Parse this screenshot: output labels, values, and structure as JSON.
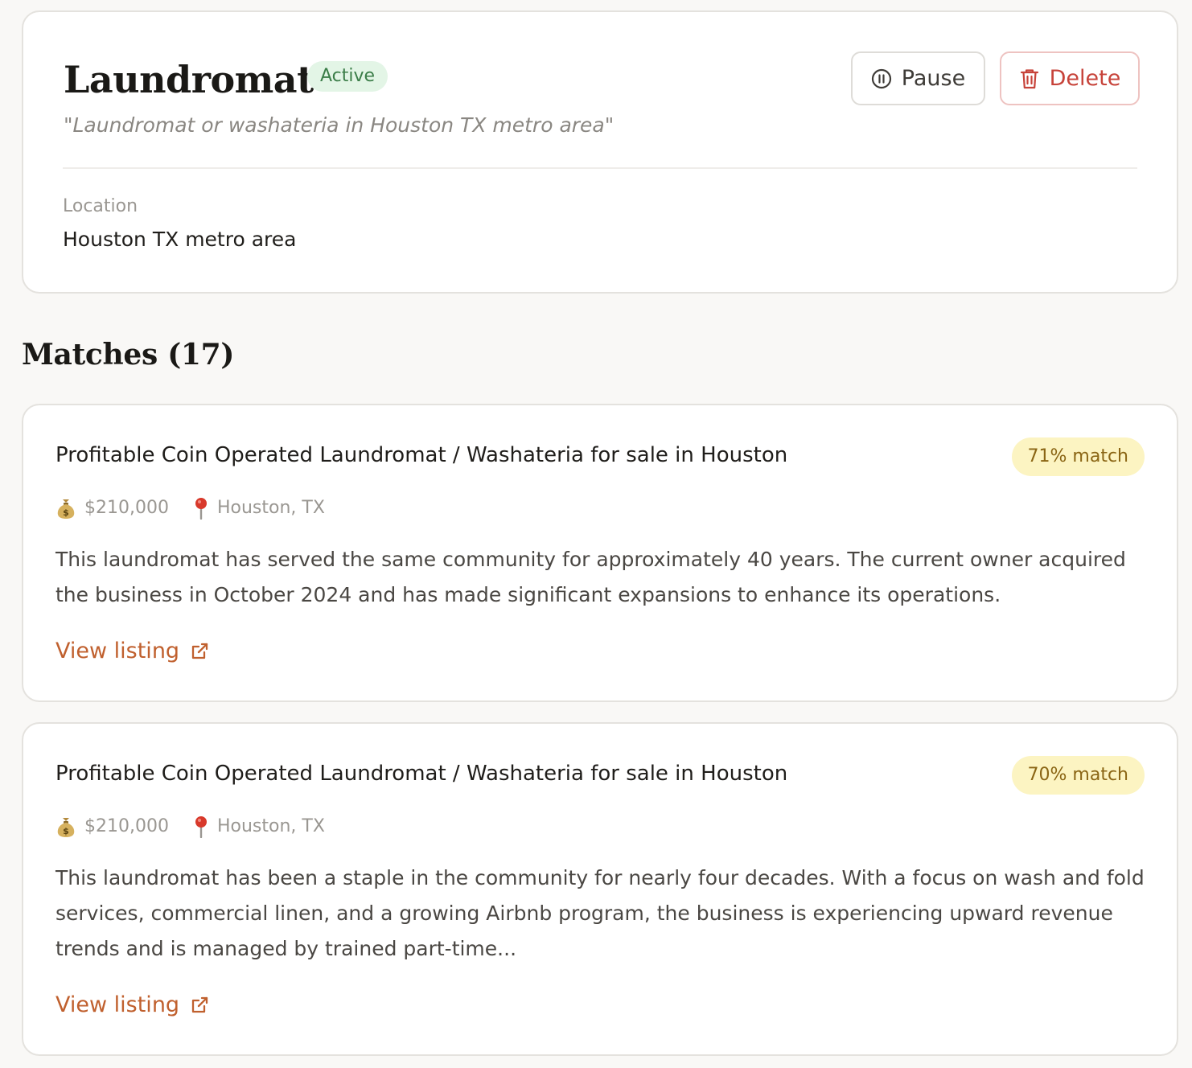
{
  "search": {
    "title": "Laundromat",
    "status": "Active",
    "query": "\"Laundromat or washateria in Houston TX metro area\"",
    "pause_label": "Pause",
    "delete_label": "Delete",
    "location_label": "Location",
    "location_value": "Houston TX metro area"
  },
  "matches": {
    "heading": "Matches (17)",
    "items": [
      {
        "title": "Profitable Coin Operated Laundromat / Washateria for sale in Houston",
        "match": "71% match",
        "price": "$210,000",
        "location": "Houston, TX",
        "description": "This laundromat has served the same community for approximately 40 years. The current owner acquired the business in October 2024 and has made significant expansions to enhance its operations.",
        "link_label": "View listing"
      },
      {
        "title": "Profitable Coin Operated Laundromat / Washateria for sale in Houston",
        "match": "70% match",
        "price": "$210,000",
        "location": "Houston, TX",
        "description": "This laundromat has been a staple in the community for nearly four decades. With a focus on wash and fold services, commercial linen, and a growing Airbnb program, the business is experiencing upward revenue trends and is managed by trained part-time...",
        "link_label": "View listing"
      }
    ]
  },
  "icons": {
    "price": "money-bag-icon",
    "location": "map-pin-icon",
    "external": "external-link-icon",
    "pause": "pause-circle-icon",
    "delete": "trash-icon"
  },
  "colors": {
    "accent": "#c0602e",
    "active_badge_bg": "#e3f5e6",
    "active_badge_text": "#3b7d48",
    "match_pill_bg": "#fcf4c2",
    "match_pill_text": "#8a6514",
    "danger": "#c7433a"
  }
}
